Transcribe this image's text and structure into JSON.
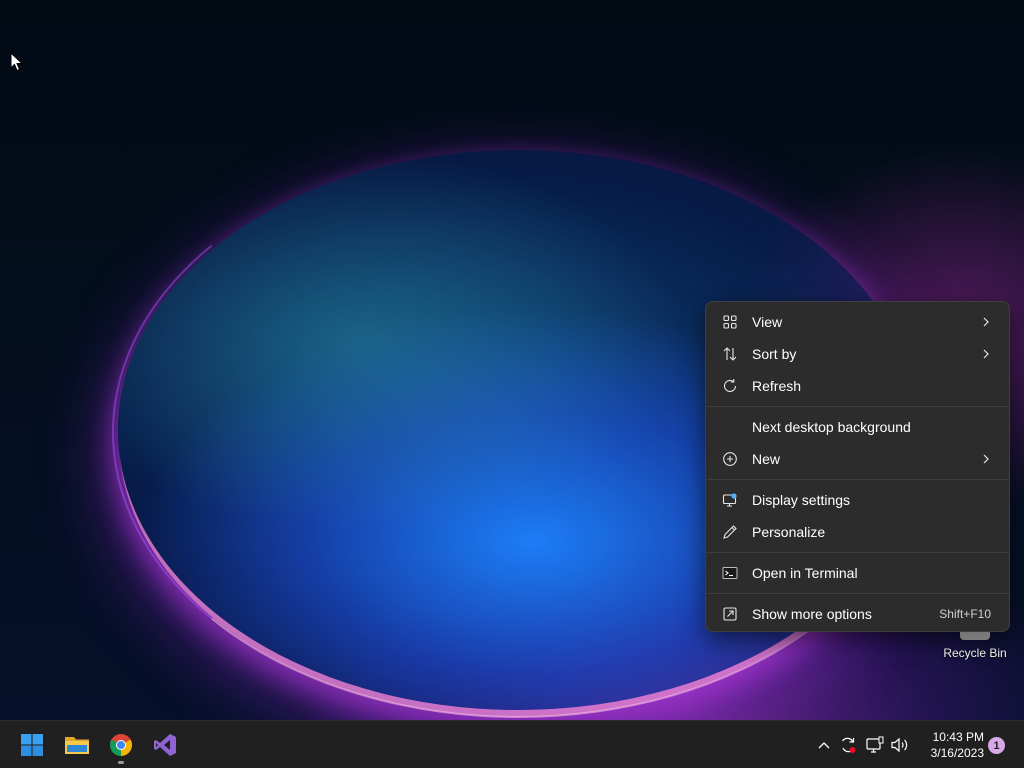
{
  "desktop": {
    "icons": [
      {
        "label": "Recycle Bin",
        "icon": "recycle-bin-icon"
      }
    ]
  },
  "context_menu": {
    "items": [
      {
        "label": "View",
        "icon": "grid-icon",
        "submenu": true
      },
      {
        "label": "Sort by",
        "icon": "sort-icon",
        "submenu": true
      },
      {
        "label": "Refresh",
        "icon": "refresh-icon",
        "submenu": false
      },
      {
        "label": "Next desktop background",
        "icon": "",
        "submenu": false
      },
      {
        "label": "New",
        "icon": "add-circle-icon",
        "submenu": true
      },
      {
        "label": "Display settings",
        "icon": "display-settings-icon",
        "submenu": false
      },
      {
        "label": "Personalize",
        "icon": "pen-icon",
        "submenu": false
      },
      {
        "label": "Open in Terminal",
        "icon": "terminal-icon",
        "submenu": false
      },
      {
        "label": "Show more options",
        "icon": "more-options-icon",
        "submenu": false,
        "shortcut": "Shift+F10"
      }
    ]
  },
  "taskbar": {
    "apps": [
      {
        "name": "Start",
        "icon": "windows-start-icon"
      },
      {
        "name": "File Explorer",
        "icon": "file-explorer-icon"
      },
      {
        "name": "Google Chrome",
        "icon": "chrome-icon",
        "running": true
      },
      {
        "name": "Visual Studio",
        "icon": "visual-studio-icon"
      }
    ],
    "tray": {
      "icons": [
        "chevron-up-icon",
        "sync-icon",
        "network-icon",
        "volume-icon"
      ],
      "time": "10:43 PM",
      "date": "3/16/2023",
      "notification_count": "1"
    }
  },
  "colors": {
    "menu_bg": "#2c2c2c",
    "taskbar_bg": "#202020",
    "accent_blue": "#0078d4",
    "notification_badge": "#d6a8e8"
  }
}
